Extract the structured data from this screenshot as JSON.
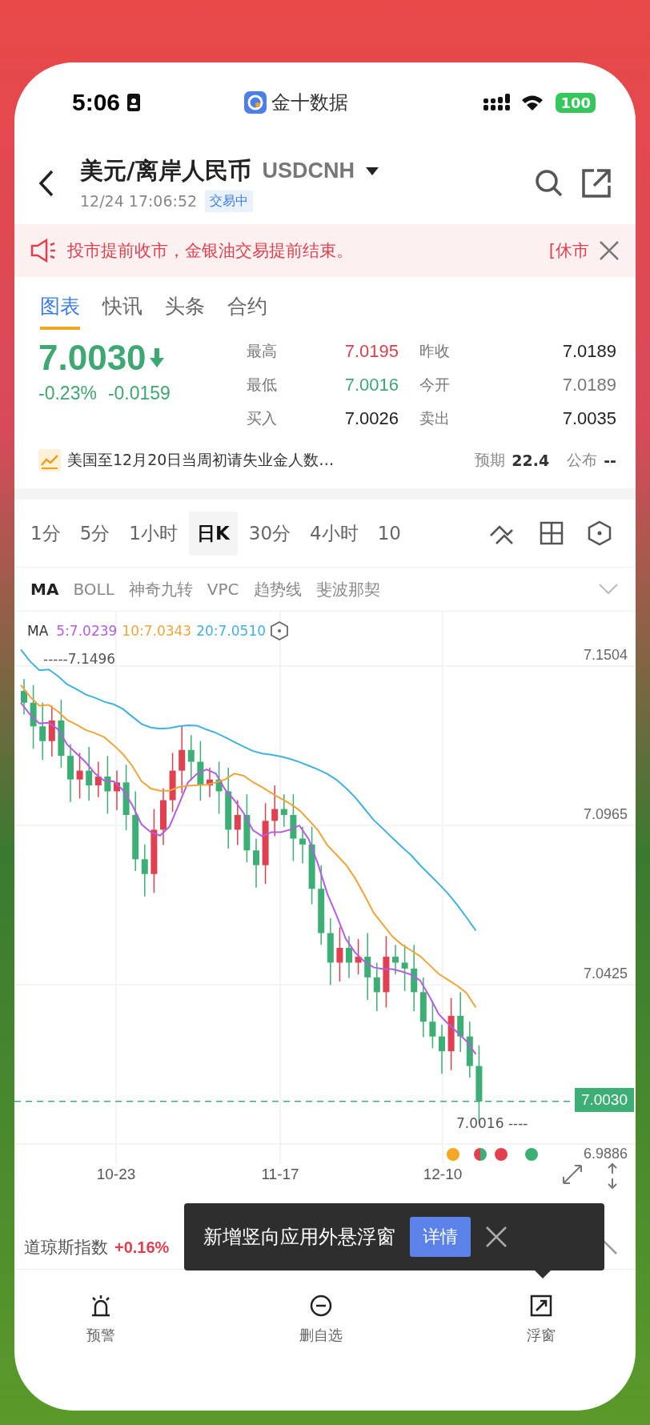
{
  "status_bar": {
    "time": "5:06",
    "app_name": "金十数据",
    "battery": "100"
  },
  "header": {
    "title": "美元/离岸人民币",
    "symbol": "USDCNH",
    "timestamp": "12/24 17:06:52",
    "status_badge": "交易中"
  },
  "notice": {
    "text": "投市提前收市，金银油交易提前结束。",
    "next_text": "[休市"
  },
  "tabs": [
    {
      "label": "图表",
      "selected": true
    },
    {
      "label": "快讯",
      "selected": false
    },
    {
      "label": "头条",
      "selected": false
    },
    {
      "label": "合约",
      "selected": false
    }
  ],
  "quote": {
    "price": "7.0030",
    "falling": true,
    "change_pct": "-0.23%",
    "change": "-0.0159",
    "stats": [
      {
        "label": "最高",
        "value": "7.0195",
        "kind": "up"
      },
      {
        "label": "昨收",
        "value": "7.0189",
        "kind": "plain"
      },
      {
        "label": "最低",
        "value": "7.0016",
        "kind": "down"
      },
      {
        "label": "今开",
        "value": "7.0189",
        "kind": "muted"
      },
      {
        "label": "买入",
        "value": "7.0026",
        "kind": "plain"
      },
      {
        "label": "卖出",
        "value": "7.0035",
        "kind": "plain"
      }
    ]
  },
  "event": {
    "title": "美国至12月20日当周初请失业金人数…",
    "expected_label": "预期",
    "expected": "22.4",
    "publish_label": "公布",
    "publish": "--"
  },
  "periods": [
    {
      "label": "1分",
      "selected": false
    },
    {
      "label": "5分",
      "selected": false
    },
    {
      "label": "1小时",
      "selected": false
    },
    {
      "label": "日K",
      "selected": true
    },
    {
      "label": "30分",
      "selected": false
    },
    {
      "label": "4小时",
      "selected": false
    },
    {
      "label": "10",
      "selected": false
    }
  ],
  "indicators": [
    {
      "label": "MA",
      "selected": true
    },
    {
      "label": "BOLL",
      "selected": false
    },
    {
      "label": "神奇九转",
      "selected": false
    },
    {
      "label": "VPC",
      "selected": false
    },
    {
      "label": "趋势线",
      "selected": false
    },
    {
      "label": "斐波那契",
      "selected": false
    }
  ],
  "chart": {
    "legend_label": "MA",
    "ma": [
      {
        "text": "5:7.0239",
        "color": "#b45de0"
      },
      {
        "text": "10:7.0343",
        "color": "#f0a43a"
      },
      {
        "text": "20:7.0510",
        "color": "#3fb2e0"
      }
    ],
    "yticks": [
      "7.1504",
      "7.0965",
      "7.0425",
      "6.9886"
    ],
    "high_marker": "-----7.1496",
    "low_marker": "7.0016 ----",
    "last_price": "7.0030",
    "xlabels": [
      "10-23",
      "11-17",
      "12-10"
    ],
    "dots": [
      {
        "kind": "solid",
        "color": "#f5a623"
      },
      {
        "kind": "split",
        "color": "#e0404f"
      },
      {
        "kind": "solid",
        "color": "#e0404f"
      },
      {
        "kind": "solid",
        "color": "#3dae75"
      }
    ]
  },
  "ticker": [
    {
      "name": "道琼斯指数",
      "change": "+0.16%"
    }
  ],
  "toast": {
    "text": "新增竖向应用外悬浮窗",
    "button": "详情"
  },
  "nav": [
    {
      "label": "预警",
      "kind": "alert"
    },
    {
      "label": "删自选",
      "kind": "remove"
    },
    {
      "label": "浮窗",
      "kind": "float"
    }
  ]
}
